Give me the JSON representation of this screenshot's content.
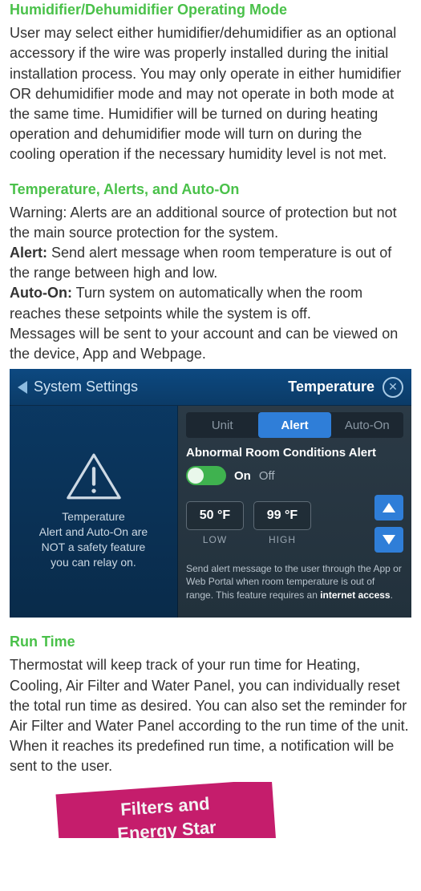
{
  "sections": {
    "humidifier": {
      "heading": "Humidifier/Dehumidifier Operating Mode",
      "body": "User may select either humidifier/dehumidifier as an optional accessory if the wire was properly installed during the initial installation process. You may only operate in either humidifier OR dehumidifier mode and may not operate in both mode at the same time. Humidifier will be turned on during heating operation and dehumidifier mode will turn on during the cooling operation if the necessary humidity level is not met."
    },
    "temp_alerts": {
      "heading": "Temperature, Alerts, and Auto-On",
      "warning": "Warning: Alerts are an additional source of protection but not the main source protection for the system.",
      "alert_lead": "Alert:",
      "alert_body": " Send alert message when room temperature is out of the range between high and low.",
      "autoon_lead": "Auto-On:",
      "autoon_body": " Turn system on automatically when the room reaches these setpoints while the system is off.",
      "messages": "Messages will be sent to your account and can be viewed on the device, App and Webpage."
    },
    "runtime": {
      "heading": "Run Time",
      "body": "Thermostat will keep track of your run time for Heating, Cooling, Air Filter and Water Panel, you can individually reset the total run time as desired. You can also set the reminder for Air Filter and Water Panel according to the run time of the unit. When it reaches its predefined run time, a notification will be sent to the user."
    }
  },
  "device": {
    "titlebar": {
      "back_label": "System Settings",
      "title": "Temperature"
    },
    "left_caption": "Temperature\nAlert and Auto-On are\nNOT a safety feature\nyou can relay on.",
    "tabs": {
      "unit": "Unit",
      "alert": "Alert",
      "autoon": "Auto-On",
      "active": "alert"
    },
    "subheading": "Abnormal Room Conditions Alert",
    "toggle": {
      "on": "On",
      "off": "Off",
      "state": "on"
    },
    "values": {
      "low": "50 °F",
      "high": "99 °F",
      "low_label": "LOW",
      "high_label": "HIGH"
    },
    "note_pre": "Send alert message to the user through the App or Web Portal when room temperature is out of range. This feature requires an ",
    "note_bold": "internet access",
    "note_post": "."
  },
  "banner": {
    "line1": "Filters and",
    "line2": "Energy Star"
  }
}
